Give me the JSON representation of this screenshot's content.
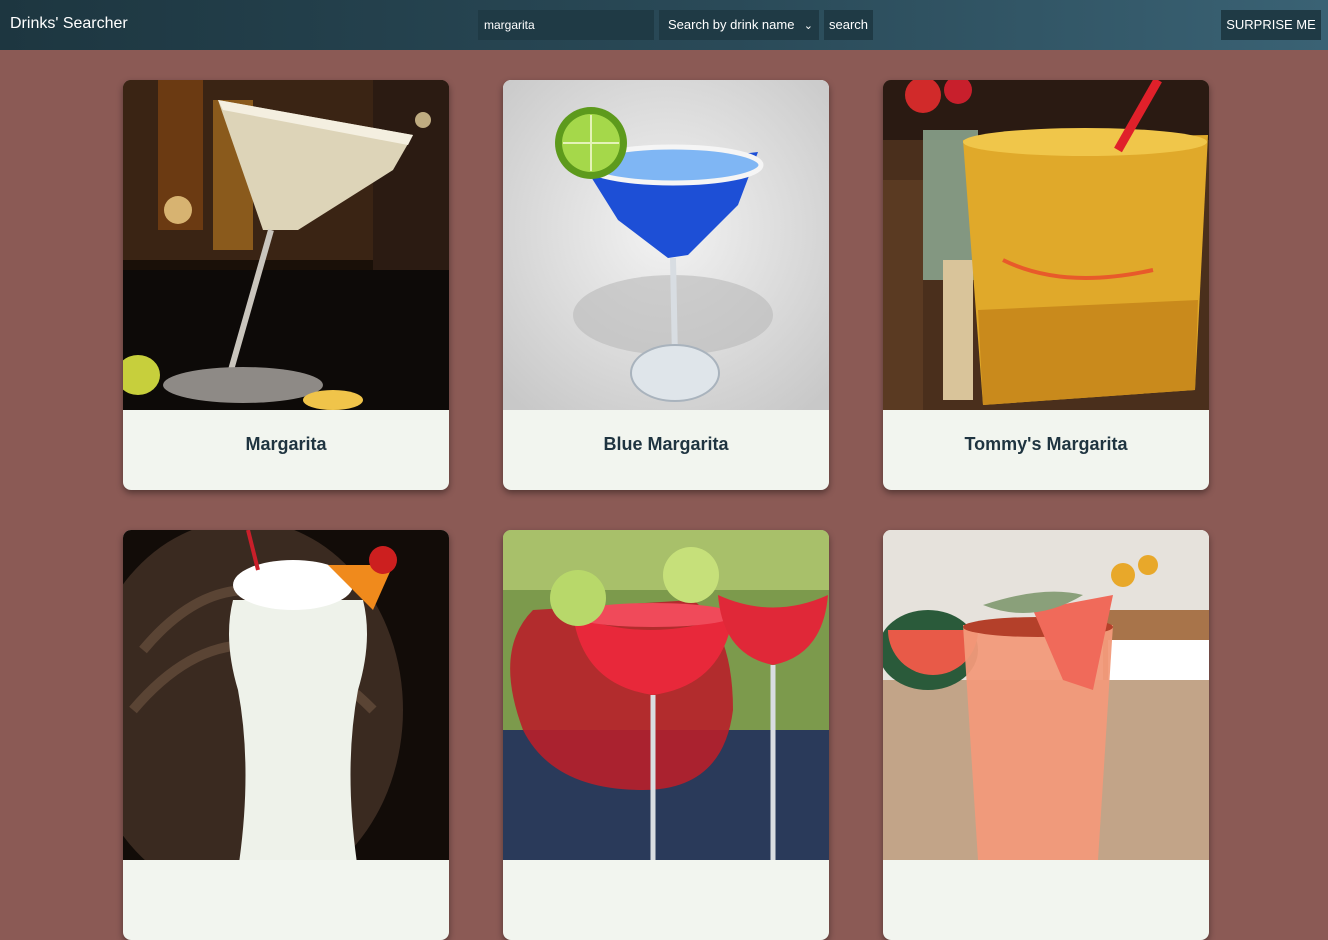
{
  "header": {
    "brand": "Drinks' Searcher",
    "search_value": "margarita",
    "search_mode": "Search by drink name",
    "search_button": "search",
    "surprise_button": "SURPRISE ME"
  },
  "drinks": [
    {
      "name": "Margarita"
    },
    {
      "name": "Blue Margarita"
    },
    {
      "name": "Tommy's Margarita"
    },
    {
      "name": ""
    },
    {
      "name": ""
    },
    {
      "name": ""
    }
  ],
  "colors": {
    "background": "#8b5a55",
    "card": "#f2f5ef",
    "title_text": "#1f3440"
  }
}
